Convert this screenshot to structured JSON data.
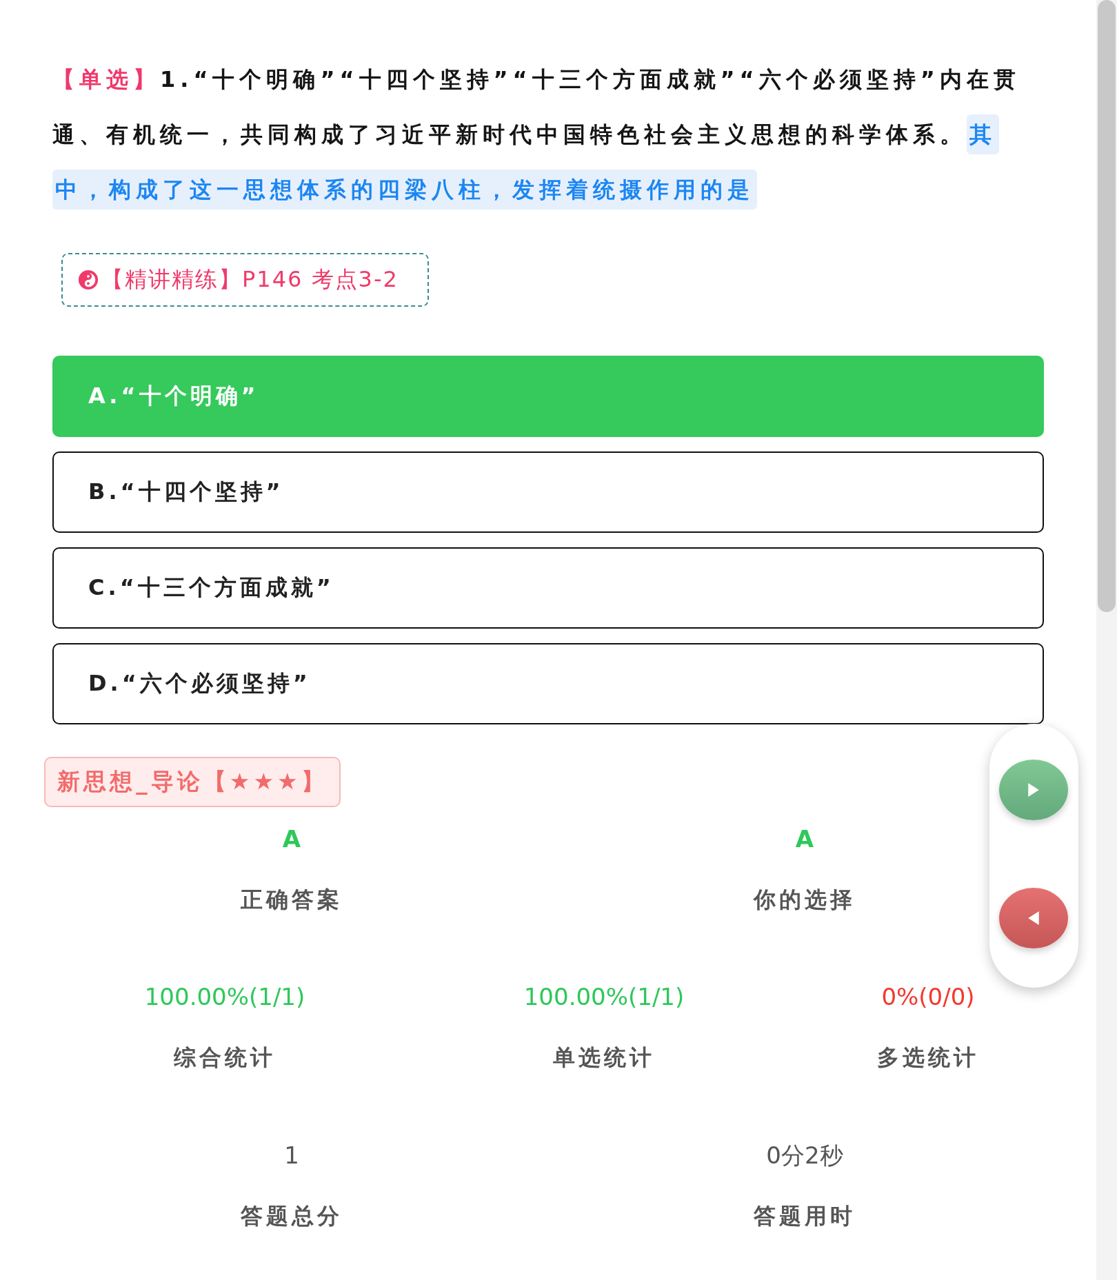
{
  "question": {
    "type_label": "【单选】",
    "text": "1.“十个明确”“十四个坚持”“十三个方面成就”“六个必须坚持”内在贯通、有机统一，共同构成了习近平新时代中国特色社会主义思想的科学体系。",
    "highlight": "其中，构成了这一思想体系的四梁八柱，发挥着统摄作用的是"
  },
  "reference_tag": {
    "text": "【精讲精练】P146 考点3-2"
  },
  "options": [
    {
      "label": "A.“十个明确”",
      "selected": true
    },
    {
      "label": "B.“十四个坚持”",
      "selected": false
    },
    {
      "label": "C.“十三个方面成就”",
      "selected": false
    },
    {
      "label": "D.“六个必须坚持”",
      "selected": false
    }
  ],
  "category_tag": "新思想_导论【★★★】",
  "answers": [
    {
      "value": "A",
      "label": "正确答案"
    },
    {
      "value": "A",
      "label": "你的选择"
    }
  ],
  "statistics": [
    {
      "value": "100.00%(1/1)",
      "label": "综合统计",
      "color": "#2ec85a"
    },
    {
      "value": "100.00%(1/1)",
      "label": "单选统计",
      "color": "#2ec85a"
    },
    {
      "value": "0%(0/0)",
      "label": "多选统计",
      "color": "#f23a2f"
    }
  ],
  "totals": [
    {
      "value": "1",
      "label": "答题总分"
    },
    {
      "value": "0分2秒",
      "label": "答题用时"
    }
  ]
}
